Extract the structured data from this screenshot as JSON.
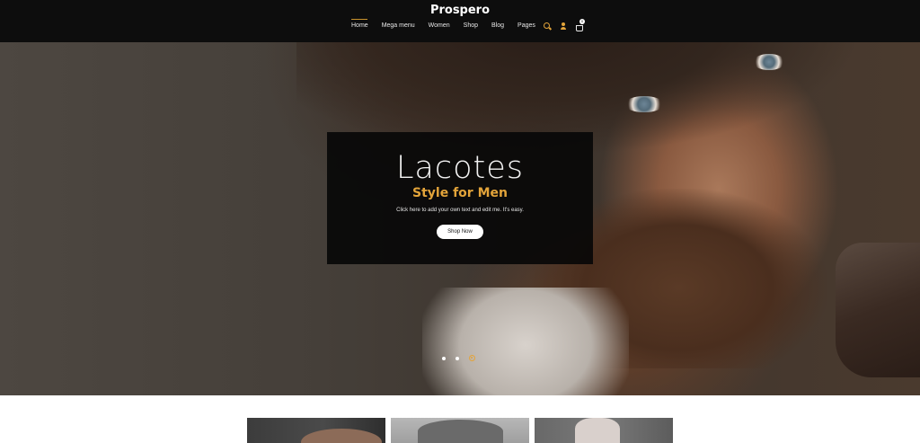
{
  "site": {
    "logo": "Prospero"
  },
  "nav": {
    "items": [
      {
        "label": "Home",
        "active": true
      },
      {
        "label": "Mega menu",
        "active": false
      },
      {
        "label": "Women",
        "active": false
      },
      {
        "label": "Shop",
        "active": false
      },
      {
        "label": "Blog",
        "active": false
      },
      {
        "label": "Pages",
        "active": false
      }
    ],
    "icons": [
      "search-icon",
      "user-icon",
      "cart-icon"
    ],
    "cart_count": "0"
  },
  "hero": {
    "title": "Lacotes",
    "subtitle": "Style for Men",
    "text": "Click here to add your own text and edit me. It's easy.",
    "button_label": "Shop Now",
    "slides_count": 3,
    "active_slide": 3
  },
  "colors": {
    "accent": "#e3a43a",
    "header_bg": "#0d0d0d"
  }
}
